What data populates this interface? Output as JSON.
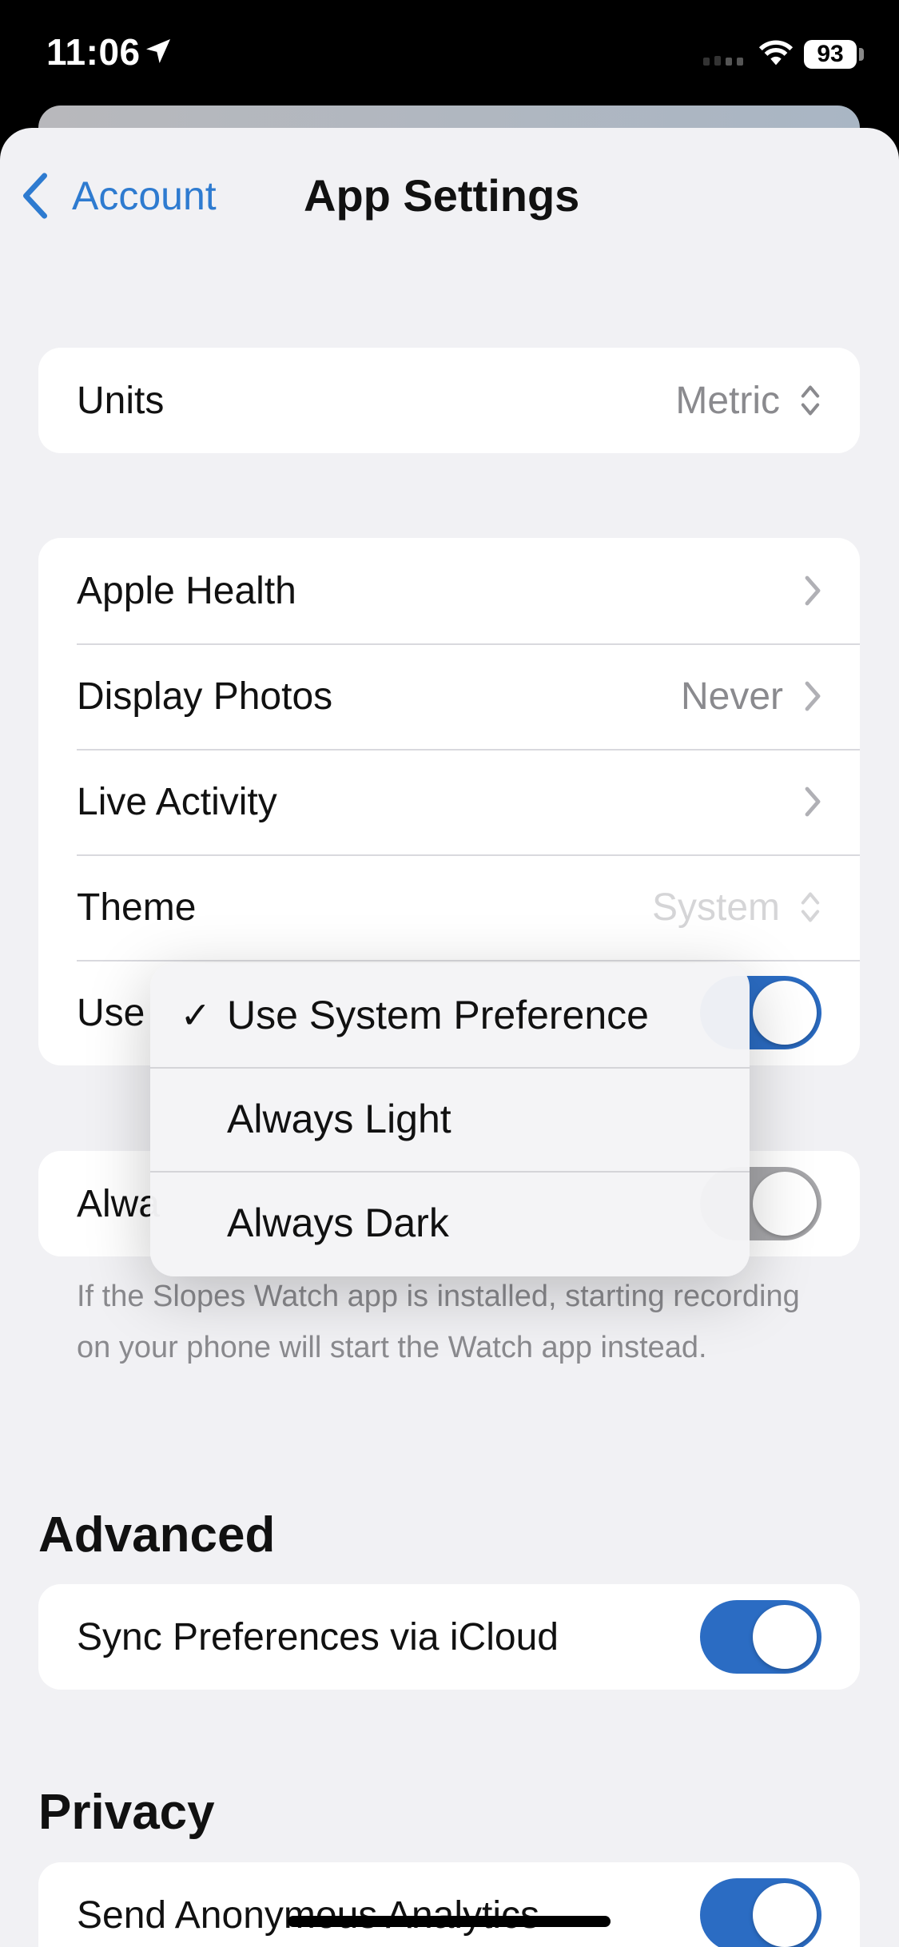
{
  "status_bar": {
    "time": "11:06",
    "battery": "93"
  },
  "nav": {
    "back_label": "Account",
    "title": "App Settings"
  },
  "units": {
    "label": "Units",
    "value": "Metric"
  },
  "settings_group": {
    "apple_health": "Apple Health",
    "display_photos": {
      "label": "Display Photos",
      "value": "Never"
    },
    "live_activity": "Live Activity",
    "theme": {
      "label": "Theme",
      "value": "System"
    },
    "use_row_label": "Use"
  },
  "watch_group": {
    "row_label": "Alwa",
    "footnote": "If the Slopes Watch app is installed, starting recording on your phone will start the Watch app instead."
  },
  "advanced": {
    "header": "Advanced",
    "sync_label": "Sync Preferences via iCloud"
  },
  "privacy": {
    "header": "Privacy",
    "analytics_label": "Send Anonymous Analytics"
  },
  "theme_menu": {
    "options": [
      "Use System Preference",
      "Always Light",
      "Always Dark"
    ],
    "selected": "Use System Preference",
    "check_glyph": "✓"
  },
  "colors": {
    "accent": "#2e7bd0",
    "toggle_on": "#2b6cc3",
    "background": "#f1f1f4"
  }
}
